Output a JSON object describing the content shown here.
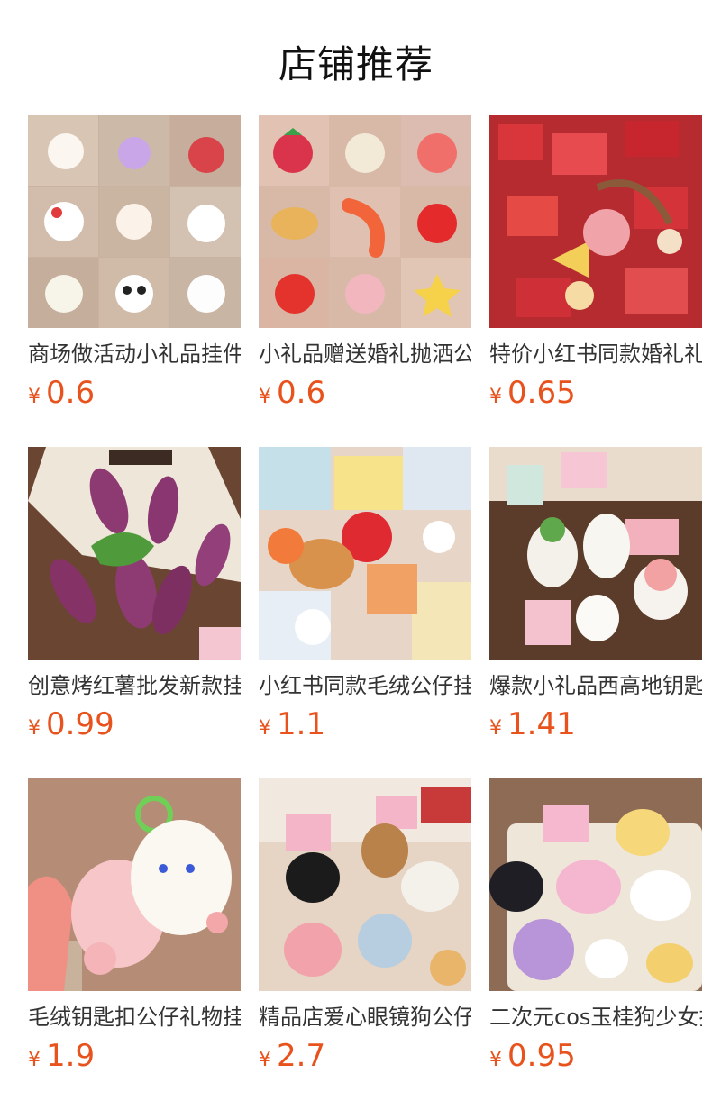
{
  "section_title": "店铺推荐",
  "products": [
    {
      "name": "商场做活动小礼品挂件",
      "currency": "¥",
      "price": "0.6"
    },
    {
      "name": "小礼品赠送婚礼抛洒公仔",
      "currency": "¥",
      "price": "0.6"
    },
    {
      "name": "特价小红书同款婚礼礼品",
      "currency": "¥",
      "price": "0.65"
    },
    {
      "name": "创意烤红薯批发新款挂件",
      "currency": "¥",
      "price": "0.99"
    },
    {
      "name": "小红书同款毛绒公仔挂件",
      "currency": "¥",
      "price": "1.1"
    },
    {
      "name": "爆款小礼品西高地钥匙扣",
      "currency": "¥",
      "price": "1.41"
    },
    {
      "name": "毛绒钥匙扣公仔礼物挂件",
      "currency": "¥",
      "price": "1.9"
    },
    {
      "name": "精品店爱心眼镜狗公仔挂件",
      "currency": "¥",
      "price": "2.7"
    },
    {
      "name": "二次元cos玉桂狗少女挂件",
      "currency": "¥",
      "price": "0.95"
    }
  ]
}
